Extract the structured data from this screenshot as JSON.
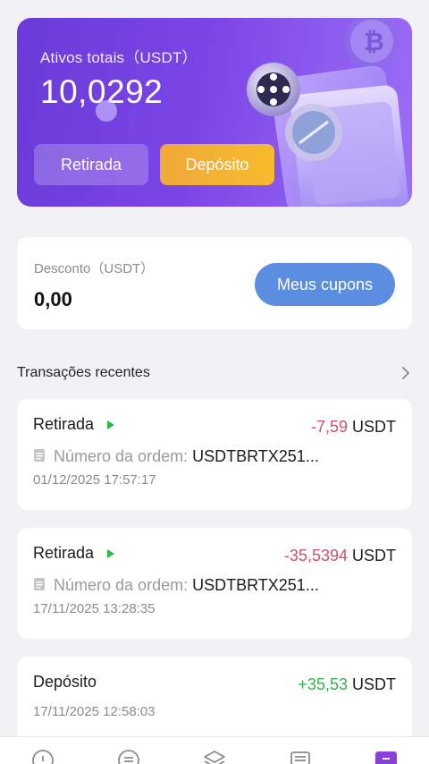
{
  "balance": {
    "label": "Ativos totais（USDT）",
    "amount": "10,0292",
    "withdraw_label": "Retirada",
    "deposit_label": "Depósito"
  },
  "discount": {
    "label": "Desconto（USDT）",
    "value": "0,00",
    "coupons_label": "Meus cupons"
  },
  "recent": {
    "title": "Transações recentes",
    "transactions": [
      {
        "type": "Retirada",
        "amount": "-7,59",
        "unit": "USDT",
        "order_label": "Número da ordem:",
        "order_value": "USDTBRTX251...",
        "date": "01/12/2025 17:57:17"
      },
      {
        "type": "Retirada",
        "amount": "-35,5394",
        "unit": "USDT",
        "order_label": "Número da ordem:",
        "order_value": "USDTBRTX251...",
        "date": "17/11/2025 13:28:35"
      },
      {
        "type": "Depósito",
        "amount": "+35,53",
        "unit": "USDT",
        "date": "17/11/2025 12:58:03"
      }
    ]
  },
  "nav": {
    "items": [
      "home-icon",
      "exchange-icon",
      "layers-icon",
      "inbox-icon",
      "wallet-icon"
    ]
  },
  "colors": {
    "card_gradient_start": "#6a3bd8",
    "deposit_button": "#f0a93a",
    "coupons_button": "#5b8de0",
    "negative": "#d0506a",
    "positive": "#33b44a",
    "nav_active": "#8b3fd9"
  }
}
